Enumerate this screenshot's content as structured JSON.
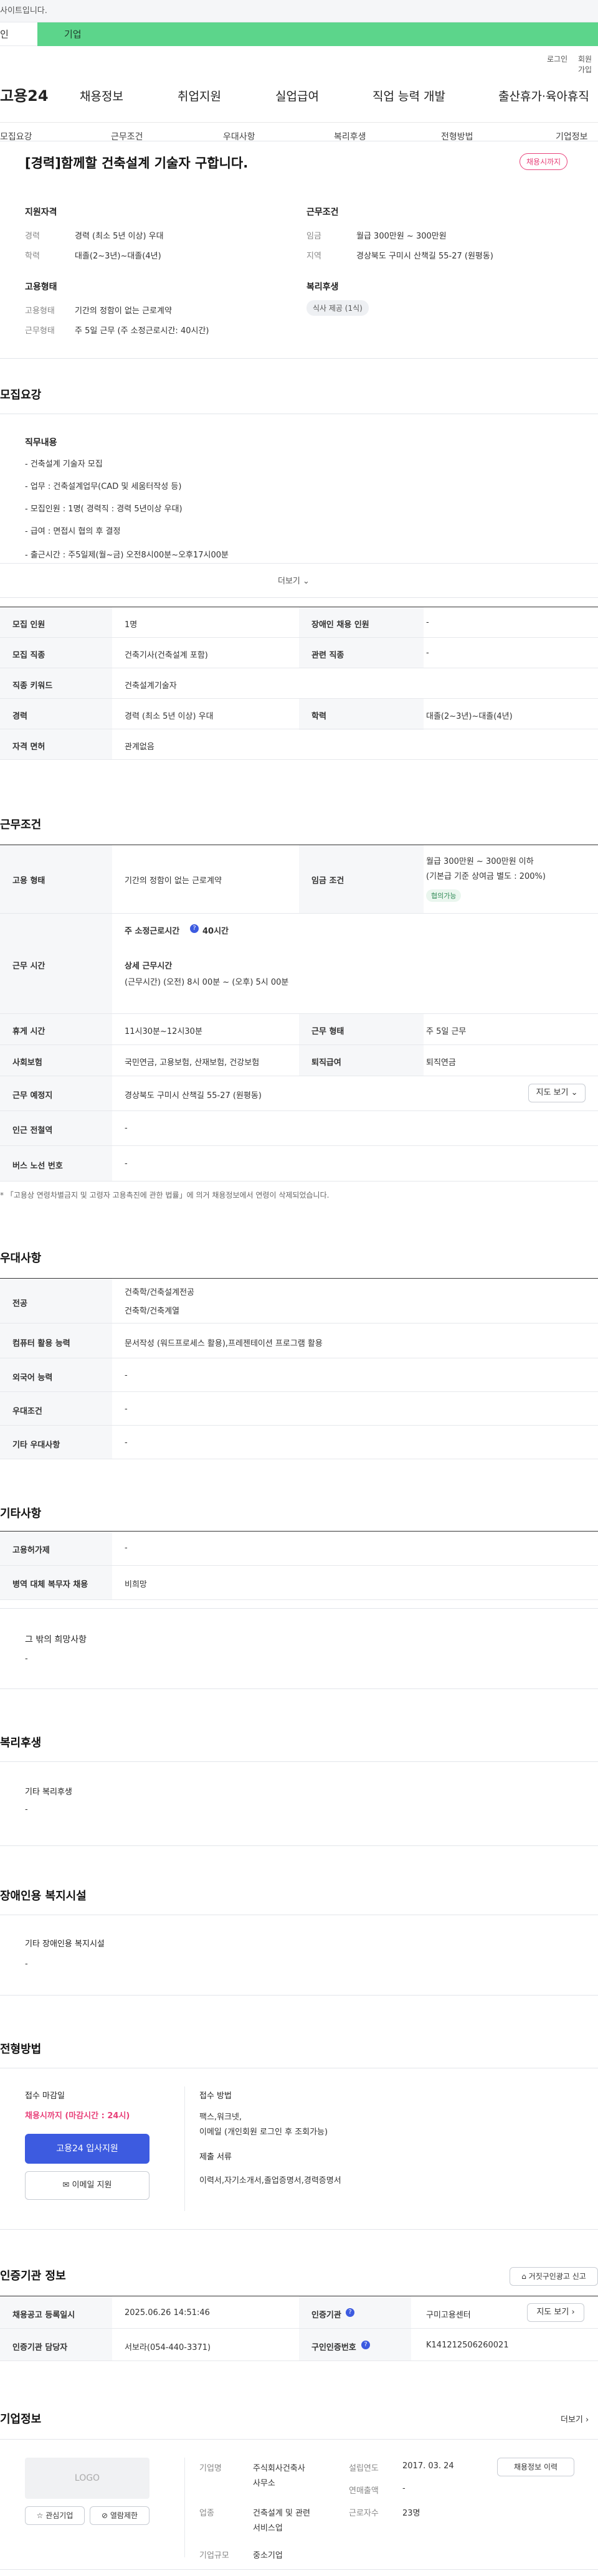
{
  "gov_banner": {
    "text": "사이트입니다."
  },
  "top_tabs": [
    "인",
    "기업"
  ],
  "util": [
    "로그인",
    "회원가입"
  ],
  "logo": "고용24",
  "gnb": [
    "채용정보",
    "취업지원",
    "실업급여",
    "직업 능력 개발",
    "출산휴가·육아휴직"
  ],
  "subnav": [
    "모집요강",
    "근무조건",
    "우대사항",
    "복리후생",
    "전형방법",
    "기업정보"
  ],
  "title": "[경력]함께할 건축설계 기술자 구합니다.",
  "status_pill": "채용시까지",
  "summary": {
    "qual_title": "지원자격",
    "qual": [
      {
        "label": "경력",
        "value": "경력 (최소 5년 이상) 우대"
      },
      {
        "label": "학력",
        "value": "대졸(2~3년)~대졸(4년)"
      }
    ],
    "work_title": "근무조건",
    "work": [
      {
        "label": "임금",
        "value": "월급 300만원 ~ 300만원"
      },
      {
        "label": "지역",
        "value": "경상북도 구미시 산책길 55-27 (원평동)"
      }
    ],
    "emp_title": "고용형태",
    "emp": [
      {
        "label": "고용형태",
        "value": "기간의 정함이 없는 근로계약"
      },
      {
        "label": "근무형태",
        "value": "주 5일 근무 (주 소정근로시간: 40시간)"
      }
    ],
    "benefit_title": "복리후생",
    "benefit_tag": "식사 제공 (1식)"
  },
  "recruit": {
    "title": "모집요강",
    "duty_title": "직무내용",
    "duty_lines": [
      "- 건축설계 기술자 모집",
      "- 업무 : 건축설계업무(CAD 및 세움터작성 등)",
      "- 모집인원 : 1명( 경력직 : 경력 5년이상 우대)",
      "- 급여 : 면접시 협의 후 결정",
      "- 출근시간 : 주5일제(월~금) 오전8시00분~오후17시00분"
    ],
    "more": "더보기",
    "rows": [
      {
        "th": "모집 인원",
        "td": "1명",
        "th2": "장애인 채용 인원",
        "td2": "-"
      },
      {
        "th": "모집 직종",
        "td": "건축기사(건축설계 포함)",
        "th2": "관련 직종",
        "td2": "-"
      },
      {
        "th": "직종 키워드",
        "td": "건축설계기술자"
      },
      {
        "th": "경력",
        "td": "경력 (최소 5년 이상) 우대",
        "th2": "학력",
        "td2": "대졸(2~3년)~대졸(4년)"
      },
      {
        "th": "자격 면허",
        "td": "관계없음"
      }
    ]
  },
  "conditions": {
    "title": "근무조건",
    "emp_th": "고용 형태",
    "emp_td": "기간의 정함이 없는 근로계약",
    "wage_th": "임금 조건",
    "wage_1": "월급 300만원 ~ 300만원 이하",
    "wage_2": "(기본급 기준 상여금 별도 : 200%)",
    "wage_tag": "협의가능",
    "hours_th": "근무 시간",
    "hours_1": "주 소정근로시간",
    "hours_1b": "40시간",
    "hours_2": "상세 근무시간",
    "hours_3": "(근무시간) (오전) 8시 00분 ~ (오후) 5시 00분",
    "rows": [
      {
        "th": "휴게 시간",
        "td": "11시30분~12시30분",
        "th2": "근무 형태",
        "td2": "주 5일 근무"
      },
      {
        "th": "사회보험",
        "td": "국민연금, 고용보험, 산재보험, 건강보험",
        "th2": "퇴직급여",
        "td2": "퇴직연금"
      },
      {
        "th": "근무 예정지",
        "td": "경상북도 구미시 산책길 55-27 (원평동)",
        "btn": "지도 보기"
      },
      {
        "th": "인근 전철역",
        "td": "-"
      },
      {
        "th": "버스 노선 번호",
        "td": "-"
      }
    ],
    "note": "* 「고용상 연령차별금지 및 고령자 고용촉진에 관한 법률」에 의거 채용정보에서 연령이 삭제되었습니다."
  },
  "pref": {
    "title": "우대사항",
    "rows": [
      {
        "th": "전공",
        "td": [
          "건축학/건축설계전공",
          "건축학/건축계열"
        ]
      },
      {
        "th": "컴퓨터 활용 능력",
        "td": [
          "문서작성 (워드프로세스 활용),프레젠테이션 프로그램 활용"
        ]
      },
      {
        "th": "외국어 능력",
        "td": [
          "-"
        ]
      },
      {
        "th": "우대조건",
        "td": [
          "-"
        ]
      },
      {
        "th": "기타 우대사항",
        "td": [
          "-"
        ]
      }
    ]
  },
  "etc": {
    "title": "기타사항",
    "rows": [
      {
        "th": "고용허가제",
        "td": "-"
      },
      {
        "th": "병역 대체 복무자 채용",
        "td": "비희망"
      }
    ],
    "box_title": "그 밖의 희망사항",
    "box_value": "-"
  },
  "welfare": {
    "title": "복리후생",
    "box_title": "기타 복리후생",
    "box_value": "-"
  },
  "disability": {
    "title": "장애인용 복지시설",
    "box_title": "기타 장애인용 복지시설",
    "box_value": "-"
  },
  "process": {
    "title": "전형방법",
    "deadline_title": "접수 마감일",
    "deadline_value": "채용시까지 (마감시간 : 24시)",
    "apply_btn": "고용24 입사지원",
    "email_btn": "이메일 지원",
    "method_title": "접수 방법",
    "method_1": "팩스,워크넷,",
    "method_2": "이메일 (개인회원 로그인 후 조회가능)",
    "docs_title": "제출 서류",
    "docs_value": "이력서,자기소개서,졸업증명서,경력증명서"
  },
  "cert": {
    "title": "인증기관 정보",
    "report_btn": "거짓구인광고 신고",
    "rows": [
      {
        "th": "채용공고 등록일시",
        "td": "2025.06.26 14:51:46",
        "th2": "인증기관",
        "td2": "구미고용센터",
        "btn": "지도 보기"
      },
      {
        "th": "인증기관 담당자",
        "td": "서보라(054-440-3371)",
        "th2": "구인인증번호",
        "td2": "K141212506260021"
      }
    ]
  },
  "company": {
    "title": "기업정보",
    "more": "더보기",
    "logo_text": "LOGO",
    "fav_btn": "관심기업",
    "block_btn": "열람제한",
    "name_lbl": "기업명",
    "name_val_1": "주식회사건축사",
    "name_val_2": "사무소",
    "ind_lbl": "업종",
    "ind_val_1": "건축설계 및 관련",
    "ind_val_2": "서비스업",
    "size_lbl": "기업규모",
    "size_val": "중소기업",
    "est_lbl": "설립연도",
    "est_val": "2017. 03. 24",
    "rev_lbl": "연매출액",
    "rev_val": "-",
    "emp_lbl": "근로자수",
    "emp_val": "23명",
    "info_btn": "채용정보 이력"
  },
  "colors": {
    "accent": "#5cd58b",
    "brand_blue": "#3d5be0",
    "pink": "#e8417a"
  }
}
